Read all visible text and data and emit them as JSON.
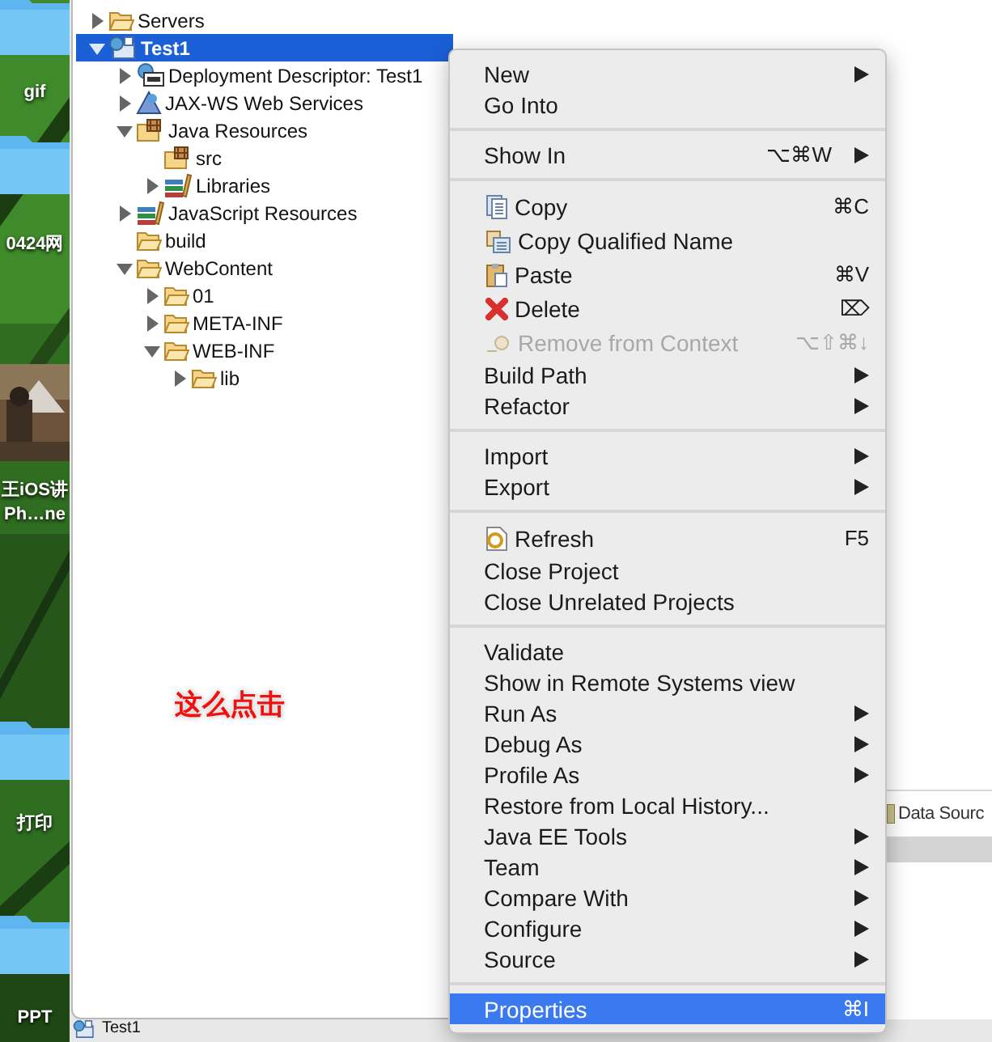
{
  "desktop": {
    "items": [
      {
        "kind": "folder",
        "lines": [
          "gif"
        ]
      },
      {
        "kind": "folder",
        "lines": [
          "0424网"
        ]
      },
      {
        "lines": [
          "王iOS讲",
          "Ph…ne"
        ]
      },
      {
        "kind": "folder",
        "lines": [
          "打印"
        ]
      },
      {
        "kind": "folder",
        "lines": [
          "PPT"
        ]
      }
    ]
  },
  "explorer": {
    "tree": [
      {
        "label": "Servers",
        "kind": "folder",
        "expanded": false,
        "selected": false
      },
      {
        "label": "Test1",
        "kind": "project",
        "expanded": true,
        "selected": true,
        "children": [
          {
            "label": "Deployment Descriptor: Test1",
            "kind": "descriptor",
            "expanded": false,
            "selected": false
          },
          {
            "label": "JAX-WS Web Services",
            "kind": "webservice",
            "expanded": false,
            "selected": false
          },
          {
            "label": "Java Resources",
            "kind": "package",
            "expanded": true,
            "selected": false,
            "children": [
              {
                "label": "src",
                "kind": "package",
                "selected": false
              },
              {
                "label": "Libraries",
                "kind": "library",
                "expanded": false,
                "selected": false
              }
            ]
          },
          {
            "label": "JavaScript Resources",
            "kind": "library",
            "expanded": false,
            "selected": false
          },
          {
            "label": "build",
            "kind": "folder",
            "selected": false
          },
          {
            "label": "WebContent",
            "kind": "folder",
            "expanded": true,
            "selected": false,
            "children": [
              {
                "label": "01",
                "kind": "folder",
                "expanded": false,
                "selected": false
              },
              {
                "label": "META-INF",
                "kind": "folder",
                "expanded": false,
                "selected": false
              },
              {
                "label": "WEB-INF",
                "kind": "folder",
                "expanded": true,
                "selected": false,
                "children": [
                  {
                    "label": "lib",
                    "kind": "folder",
                    "expanded": false,
                    "selected": false
                  }
                ]
              }
            ]
          }
        ]
      }
    ]
  },
  "annotation": "这么点击",
  "editor": {
    "panel_tab": "Data Sourc"
  },
  "status_bar": {
    "label": "Test1"
  },
  "context_menu": {
    "sections": [
      [
        {
          "label": "New",
          "submenu": true,
          "disabled": false,
          "selected": false
        },
        {
          "label": "Go Into",
          "submenu": false,
          "disabled": false,
          "selected": false
        }
      ],
      [
        {
          "label": "Show In",
          "shortcut": "⌥⌘W",
          "submenu": true,
          "disabled": false,
          "selected": false
        }
      ],
      [
        {
          "label": "Copy",
          "kind": "copy",
          "shortcut": "⌘C",
          "submenu": false,
          "disabled": false,
          "selected": false
        },
        {
          "label": "Copy Qualified Name",
          "kind": "copy-name",
          "submenu": false,
          "disabled": false,
          "selected": false
        },
        {
          "label": "Paste",
          "kind": "paste",
          "shortcut": "⌘V",
          "submenu": false,
          "disabled": false,
          "selected": false
        },
        {
          "label": "Delete",
          "kind": "delete",
          "shortcut": "⌦",
          "submenu": false,
          "disabled": false,
          "selected": false
        },
        {
          "label": "Remove from Context",
          "kind": "remove",
          "shortcut": "⌥⇧⌘↓",
          "submenu": false,
          "disabled": true,
          "selected": false
        },
        {
          "label": "Build Path",
          "submenu": true,
          "disabled": false,
          "selected": false
        },
        {
          "label": "Refactor",
          "submenu": true,
          "disabled": false,
          "selected": false
        }
      ],
      [
        {
          "label": "Import",
          "submenu": true,
          "disabled": false,
          "selected": false
        },
        {
          "label": "Export",
          "submenu": true,
          "disabled": false,
          "selected": false
        }
      ],
      [
        {
          "label": "Refresh",
          "kind": "refresh",
          "shortcut": "F5",
          "submenu": false,
          "disabled": false,
          "selected": false
        },
        {
          "label": "Close Project",
          "submenu": false,
          "disabled": false,
          "selected": false
        },
        {
          "label": "Close Unrelated Projects",
          "submenu": false,
          "disabled": false,
          "selected": false
        }
      ],
      [
        {
          "label": "Validate",
          "submenu": false,
          "disabled": false,
          "selected": false
        },
        {
          "label": "Show in Remote Systems view",
          "submenu": false,
          "disabled": false,
          "selected": false
        },
        {
          "label": "Run As",
          "submenu": true,
          "disabled": false,
          "selected": false
        },
        {
          "label": "Debug As",
          "submenu": true,
          "disabled": false,
          "selected": false
        },
        {
          "label": "Profile As",
          "submenu": true,
          "disabled": false,
          "selected": false
        },
        {
          "label": "Restore from Local History...",
          "submenu": false,
          "disabled": false,
          "selected": false
        },
        {
          "label": "Java EE Tools",
          "submenu": true,
          "disabled": false,
          "selected": false
        },
        {
          "label": "Team",
          "submenu": true,
          "disabled": false,
          "selected": false
        },
        {
          "label": "Compare With",
          "submenu": true,
          "disabled": false,
          "selected": false
        },
        {
          "label": "Configure",
          "submenu": true,
          "disabled": false,
          "selected": false
        },
        {
          "label": "Source",
          "submenu": true,
          "disabled": false,
          "selected": false
        }
      ],
      [
        {
          "label": "Properties",
          "shortcut": "⌘I",
          "submenu": false,
          "disabled": false,
          "selected": true
        }
      ]
    ]
  }
}
